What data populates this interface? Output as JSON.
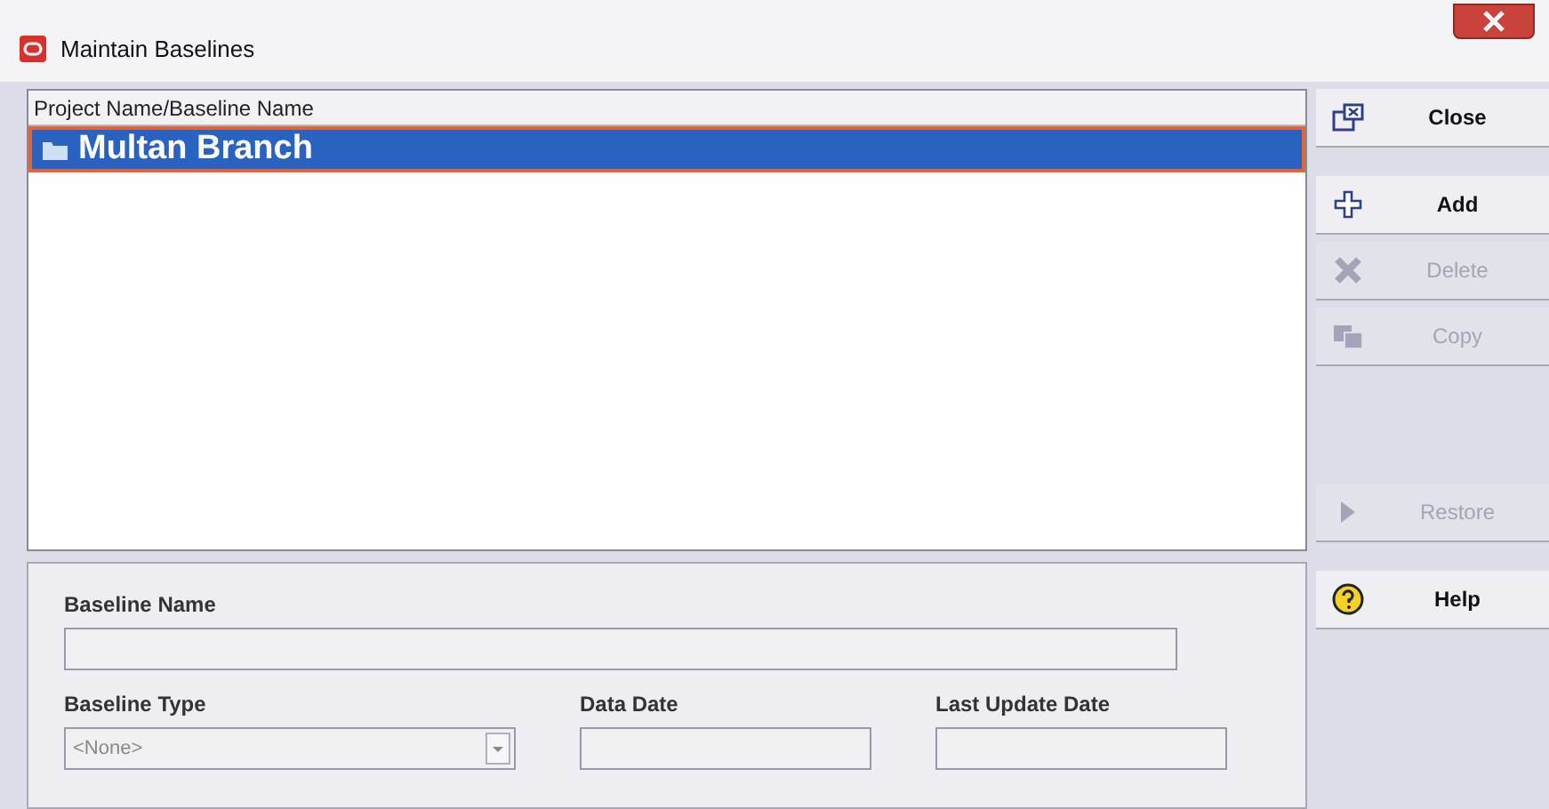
{
  "window": {
    "title": "Maintain Baselines"
  },
  "tree": {
    "column": "Project Name/Baseline Name",
    "rows": [
      {
        "label": "Multan Branch",
        "selected": true
      }
    ]
  },
  "form": {
    "baseline_name": {
      "label": "Baseline Name"
    },
    "baseline_type": {
      "label": "Baseline Type",
      "value": "<None>"
    },
    "data_date": {
      "label": "Data Date"
    },
    "last_update_date": {
      "label": "Last Update Date"
    }
  },
  "buttons": [
    {
      "kind": "close",
      "label": "Close",
      "disabled": false
    },
    {
      "kind": "add",
      "label": "Add",
      "disabled": false
    },
    {
      "kind": "delete",
      "label": "Delete",
      "disabled": true
    },
    {
      "kind": "copy",
      "label": "Copy",
      "disabled": true
    },
    {
      "kind": "restore",
      "label": "Restore",
      "disabled": true
    },
    {
      "kind": "help",
      "label": "Help",
      "disabled": false
    }
  ]
}
